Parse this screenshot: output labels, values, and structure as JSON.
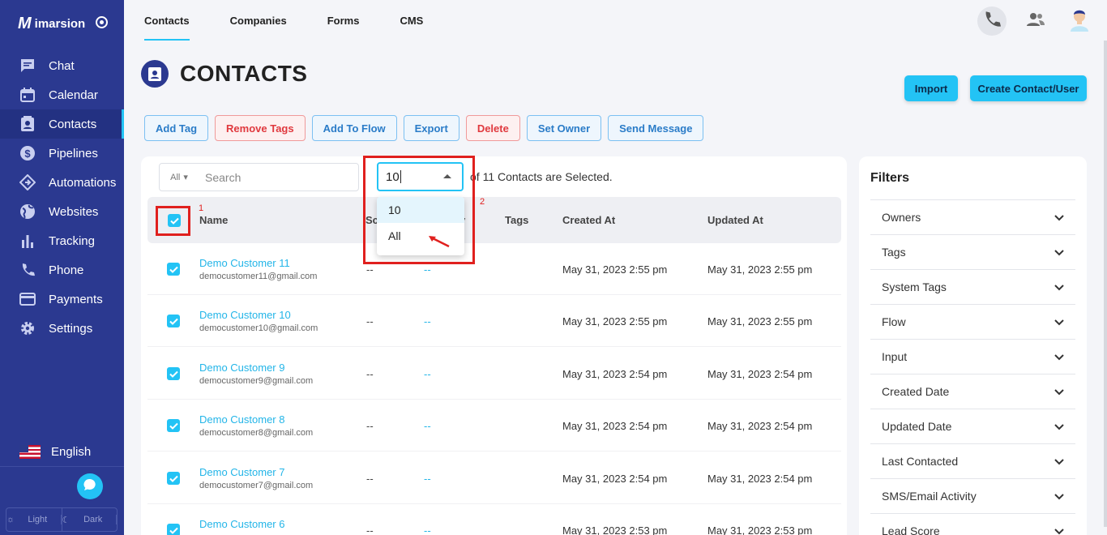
{
  "brand": {
    "logo_text": "imarsion"
  },
  "sidebar": {
    "items": [
      {
        "label": "Chat"
      },
      {
        "label": "Calendar"
      },
      {
        "label": "Contacts"
      },
      {
        "label": "Pipelines"
      },
      {
        "label": "Automations"
      },
      {
        "label": "Websites"
      },
      {
        "label": "Tracking"
      },
      {
        "label": "Phone"
      },
      {
        "label": "Payments"
      },
      {
        "label": "Settings"
      }
    ],
    "language": "English",
    "theme": {
      "light": "Light",
      "dark": "Dark"
    }
  },
  "tabs": [
    {
      "label": "Contacts"
    },
    {
      "label": "Companies"
    },
    {
      "label": "Forms"
    },
    {
      "label": "CMS"
    }
  ],
  "page": {
    "title": "CONTACTS",
    "import_label": "Import",
    "create_label": "Create Contact/User"
  },
  "actions": {
    "add_tag": "Add Tag",
    "remove_tags": "Remove Tags",
    "add_to_flow": "Add To Flow",
    "export": "Export",
    "delete": "Delete",
    "set_owner": "Set Owner",
    "send_message": "Send Message"
  },
  "search": {
    "scope": "All",
    "placeholder": "Search"
  },
  "selection": {
    "value": "10",
    "text": "of 11 Contacts are Selected.",
    "options": [
      "10",
      "All"
    ]
  },
  "table": {
    "headers": {
      "name": "Name",
      "score": "Sc",
      "y": "y",
      "tags": "Tags",
      "created": "Created At",
      "updated": "Updated At"
    },
    "rows": [
      {
        "name": "Demo Customer 11",
        "email": "democustomer11@gmail.com",
        "c1": "--",
        "c2": "--",
        "created": "May 31, 2023 2:55 pm",
        "updated": "May 31, 2023 2:55 pm"
      },
      {
        "name": "Demo Customer 10",
        "email": "democustomer10@gmail.com",
        "c1": "--",
        "c2": "--",
        "created": "May 31, 2023 2:55 pm",
        "updated": "May 31, 2023 2:55 pm"
      },
      {
        "name": "Demo Customer 9",
        "email": "democustomer9@gmail.com",
        "c1": "--",
        "c2": "--",
        "created": "May 31, 2023 2:54 pm",
        "updated": "May 31, 2023 2:54 pm"
      },
      {
        "name": "Demo Customer 8",
        "email": "democustomer8@gmail.com",
        "c1": "--",
        "c2": "--",
        "created": "May 31, 2023 2:54 pm",
        "updated": "May 31, 2023 2:54 pm"
      },
      {
        "name": "Demo Customer 7",
        "email": "democustomer7@gmail.com",
        "c1": "--",
        "c2": "--",
        "created": "May 31, 2023 2:54 pm",
        "updated": "May 31, 2023 2:54 pm"
      },
      {
        "name": "Demo Customer 6",
        "email": "",
        "c1": "--",
        "c2": "--",
        "created": "May 31, 2023 2:53 pm",
        "updated": "May 31, 2023 2:53 pm"
      }
    ]
  },
  "filters": {
    "title": "Filters",
    "items": [
      {
        "label": "Owners"
      },
      {
        "label": "Tags"
      },
      {
        "label": "System Tags"
      },
      {
        "label": "Flow"
      },
      {
        "label": "Input"
      },
      {
        "label": "Created Date"
      },
      {
        "label": "Updated Date"
      },
      {
        "label": "Last Contacted"
      },
      {
        "label": "SMS/Email Activity"
      },
      {
        "label": "Lead Score"
      }
    ]
  },
  "annotations": {
    "one": "1",
    "two": "2"
  },
  "colors": {
    "sidebar": "#2b3990",
    "accent": "#23c3f5",
    "danger": "#e0393e",
    "annotation": "#e0201e"
  }
}
